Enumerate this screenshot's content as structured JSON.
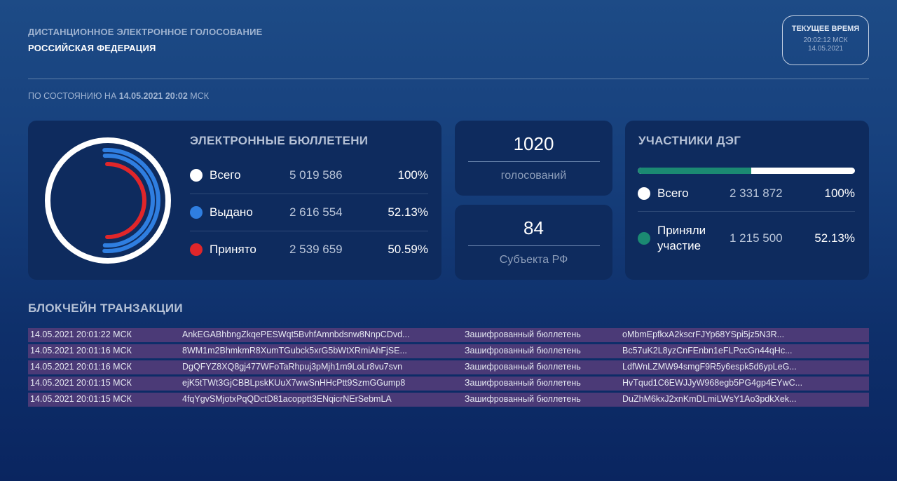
{
  "header": {
    "subtitle": "ДИСТАНЦИОННОЕ ЭЛЕКТРОННОЕ ГОЛОСОВАНИЕ",
    "title": "РОССИЙСКАЯ ФЕДЕРАЦИЯ"
  },
  "clock": {
    "label": "ТЕКУЩЕЕ ВРЕМЯ",
    "time": "20:02:12 МСК",
    "date": "14.05.2021"
  },
  "status": {
    "prefix": "ПО СОСТОЯНИЮ НА",
    "datetime": "14.05.2021 20:02",
    "suffix": "МСК"
  },
  "ballots": {
    "title": "ЭЛЕКТРОННЫЕ БЮЛЛЕТЕНИ",
    "rows": [
      {
        "label": "Всего",
        "value": "5 019 586",
        "percent": "100%",
        "color": "#ffffff"
      },
      {
        "label": "Выдано",
        "value": "2 616 554",
        "percent": "52.13%",
        "color": "#2f7ee0"
      },
      {
        "label": "Принято",
        "value": "2 539 659",
        "percent": "50.59%",
        "color": "#e0262a"
      }
    ],
    "ring_fractions": {
      "total": 1.0,
      "issued": 0.5213,
      "accepted": 0.5059
    }
  },
  "votes": {
    "value": "1020",
    "label": "голосований"
  },
  "subjects": {
    "value": "84",
    "label": "Субъекта РФ"
  },
  "participants": {
    "title": "УЧАСТНИКИ ДЭГ",
    "progress_fraction": 0.5213,
    "progress_color": "#1b8a72",
    "rows": [
      {
        "label": "Всего",
        "value": "2 331 872",
        "percent": "100%",
        "color": "#ffffff"
      },
      {
        "label": "Приняли участие",
        "label_line1": "Приняли",
        "label_line2": "участие",
        "value": "1 215 500",
        "percent": "52.13%",
        "color": "#1b8a72"
      }
    ]
  },
  "blockchain": {
    "title": "БЛОКЧЕЙН ТРАНЗАКЦИИ",
    "rows": [
      {
        "time": "14.05.2021 20:01:22 МСК",
        "hash": "AnkEGABhbngZkqePESWqt5BvhfAmnbdsnw8NnpCDvd...",
        "type": "Зашифрованный бюллетень",
        "sig": "oMbmEpfkxA2kscrFJYp68YSpi5jz5N3R..."
      },
      {
        "time": "14.05.2021 20:01:16 МСК",
        "hash": "8WM1m2BhmkmR8XumTGubck5xrG5bWtXRmiAhFjSE...",
        "type": "Зашифрованный бюллетень",
        "sig": "Bc57uK2L8yzCnFEnbn1eFLPccGn44qHc..."
      },
      {
        "time": "14.05.2021 20:01:16 МСК",
        "hash": "DgQFYZ8XQ8gj477WFoTaRhpuj3pMjh1m9LoLr8vu7svn",
        "type": "Зашифрованный бюллетень",
        "sig": "LdfWnLZMW94smgF9R5y6espk5d6ypLeG..."
      },
      {
        "time": "14.05.2021 20:01:15 МСК",
        "hash": "ejK5tTWt3GjCBBLpskKUuX7wwSnHHcPtt9SzmGGump8",
        "type": "Зашифрованный бюллетень",
        "sig": "HvTqud1C6EWJJyW968egb5PG4gp4EYwC..."
      },
      {
        "time": "14.05.2021 20:01:15 МСК",
        "hash": "4fqYgvSMjotxPqQDctD81acopptt3ENqicrNErSebmLA",
        "type": "Зашифрованный бюллетень",
        "sig": "DuZhM6kxJ2xnKmDLmiLWsY1Ao3pdkXek..."
      }
    ]
  }
}
